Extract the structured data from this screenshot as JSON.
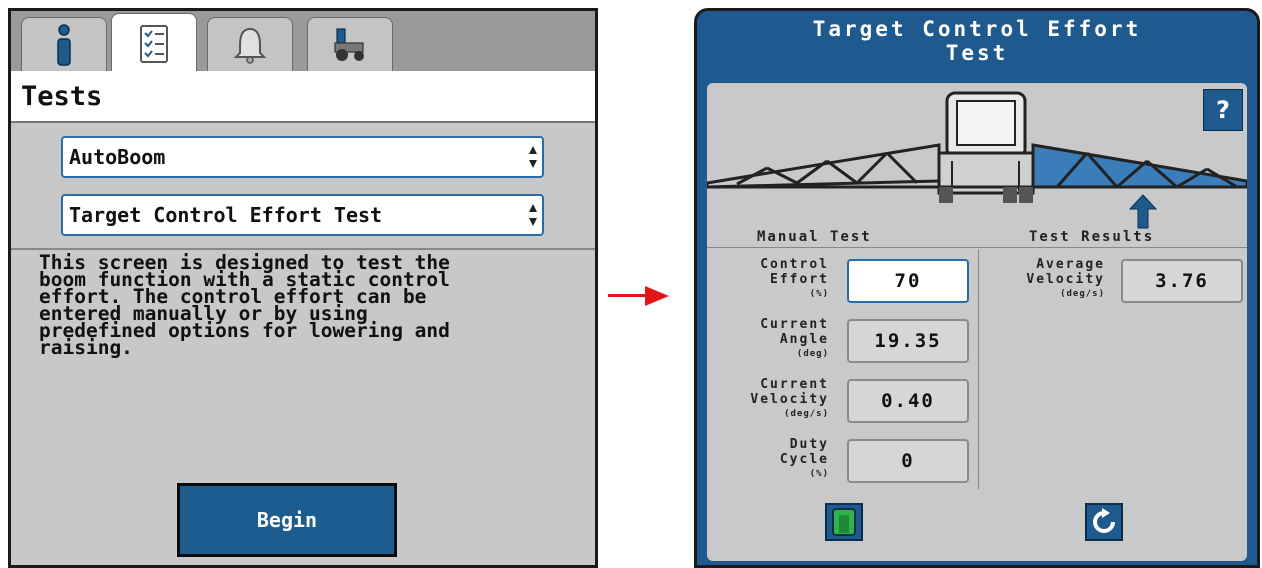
{
  "left": {
    "tabs": [
      {
        "icon": "info-icon"
      },
      {
        "icon": "checklist-icon",
        "active": true
      },
      {
        "icon": "bell-icon"
      },
      {
        "icon": "tractor-icon"
      }
    ],
    "title": "Tests",
    "system_select": {
      "value": "AutoBoom"
    },
    "test_select": {
      "value": "Target Control Effort Test"
    },
    "description": "This screen is designed to test the\nboom function with a static control\neffort. The control effort can be\nentered manually or by using\npredefined options for lowering and\nraising.",
    "begin_label": "Begin"
  },
  "right": {
    "title_line1": "Target Control Effort",
    "title_line2": "Test",
    "help_label": "?",
    "manual_header": "Manual Test",
    "results_header": "Test Results",
    "fields": {
      "control_effort": {
        "l1": "Control",
        "l2": "Effort",
        "unit": "(%)",
        "value": "70"
      },
      "current_angle": {
        "l1": "Current",
        "l2": "Angle",
        "unit": "(deg)",
        "value": "19.35"
      },
      "current_velocity": {
        "l1": "Current",
        "l2": "Velocity",
        "unit": "(deg/s)",
        "value": "0.40"
      },
      "duty_cycle": {
        "l1": "Duty",
        "l2": "Cycle",
        "unit": "(%)",
        "value": "0"
      },
      "average_velocity": {
        "l1": "Average",
        "l2": "Velocity",
        "unit": "(deg/s)",
        "value": "3.76"
      }
    }
  },
  "colors": {
    "accent": "#1f5a8e",
    "arrow": "#e3171b",
    "panel_bg": "#c9c9c9"
  }
}
